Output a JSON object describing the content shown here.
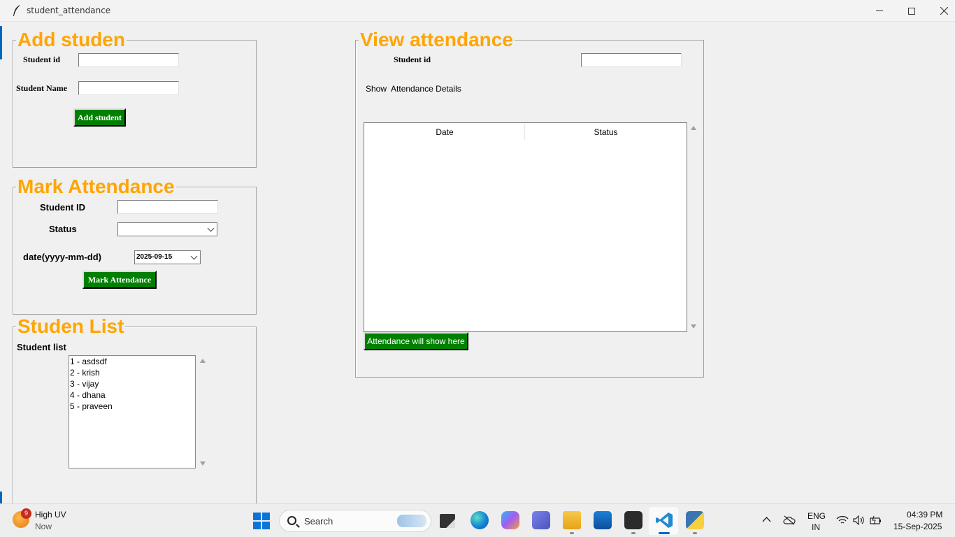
{
  "window": {
    "title": "student_attendance"
  },
  "add_student": {
    "frame_title": "Add studen",
    "id_label": "Student id",
    "name_label": "Student Name",
    "id_value": "",
    "name_value": "",
    "button": "Add student"
  },
  "mark_attendance": {
    "frame_title": "Mark Attendance",
    "id_label": "Student ID",
    "status_label": "Status",
    "date_label": "date(yyyy-mm-dd)",
    "id_value": "",
    "status_value": "",
    "date_value": "2025-09-15",
    "button": "Mark Attendance"
  },
  "student_list": {
    "frame_title": "Studen List",
    "label": "Student list",
    "items": [
      "1 - asdsdf",
      "2 - krish",
      "3 - vijay",
      "4 - dhana",
      "5 - praveen"
    ]
  },
  "view_attendance": {
    "frame_title": "View attendance",
    "id_label": "Student id",
    "id_value": "",
    "subtitle": "Show  Attendance Details",
    "columns": [
      "Date",
      "Status"
    ],
    "rows": [],
    "button": "Attendance will show here"
  },
  "taskbar": {
    "weather_badge": "9",
    "weather_line1": "High UV",
    "weather_line2": "Now",
    "search_placeholder": "Search",
    "lang_line1": "ENG",
    "lang_line2": "IN",
    "time": "04:39 PM",
    "date": "15-Sep-2025",
    "apps": [
      "task-view",
      "edge",
      "copilot",
      "teams",
      "file-explorer",
      "store",
      "terminal",
      "vscode",
      "python"
    ]
  },
  "colors": {
    "accent_title": "#ffa500",
    "button_green": "#008000",
    "taskbar_active": "#0067c0"
  }
}
